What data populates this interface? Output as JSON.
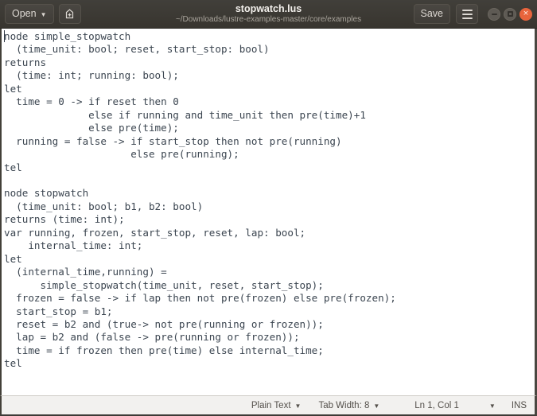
{
  "window": {
    "title": "stopwatch.lus",
    "subtitle": "~/Downloads/lustre-examples-master/core/examples"
  },
  "toolbar": {
    "open_label": "Open",
    "open_caret": "▼",
    "new_document_icon": "new-document-icon",
    "save_label": "Save",
    "menu_icon": "hamburger-menu-icon"
  },
  "window_controls": {
    "minimize": "minimize-icon",
    "maximize": "maximize-icon",
    "close": "×",
    "close_color": "#e8643c"
  },
  "editor": {
    "text": "node simple_stopwatch\n  (time_unit: bool; reset, start_stop: bool)\nreturns\n  (time: int; running: bool);\nlet\n  time = 0 -> if reset then 0\n              else if running and time_unit then pre(time)+1\n              else pre(time);\n  running = false -> if start_stop then not pre(running)\n                     else pre(running);\ntel\n\nnode stopwatch\n  (time_unit: bool; b1, b2: bool)\nreturns (time: int);\nvar running, frozen, start_stop, reset, lap: bool;\n    internal_time: int;\nlet\n  (internal_time,running) =\n      simple_stopwatch(time_unit, reset, start_stop);\n  frozen = false -> if lap then not pre(frozen) else pre(frozen);\n  start_stop = b1;\n  reset = b2 and (true-> not pre(running or frozen));\n  lap = b2 and (false -> pre(running or frozen));\n  time = if frozen then pre(time) else internal_time;\ntel"
  },
  "statusbar": {
    "language": "Plain Text",
    "language_caret": "▼",
    "tab_width": "Tab Width: 8",
    "tab_width_caret": "▼",
    "cursor_position": "Ln 1, Col 1",
    "position_caret": "▼",
    "insert_mode": "INS"
  }
}
